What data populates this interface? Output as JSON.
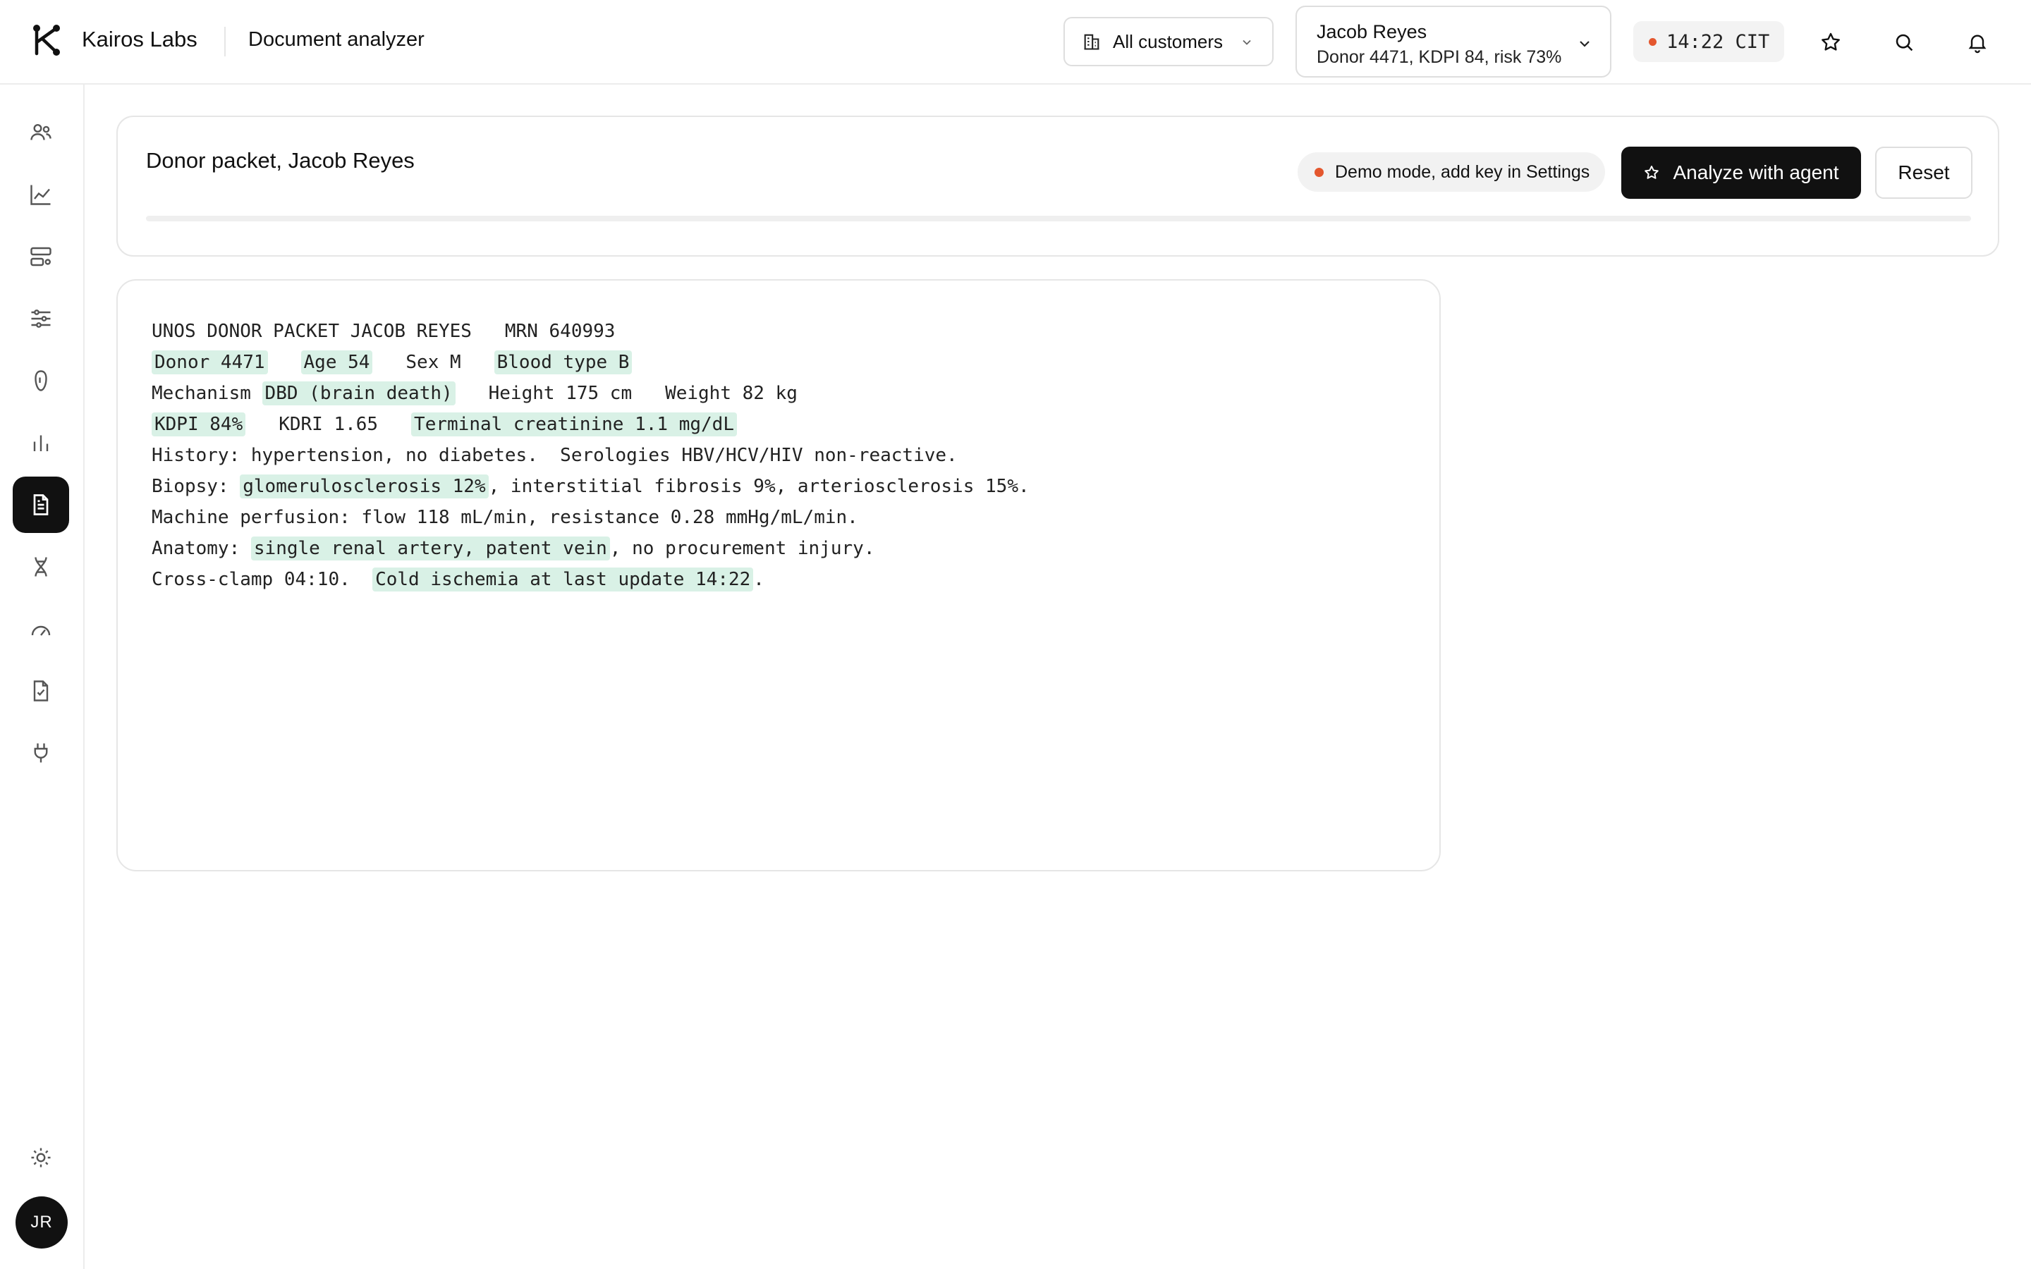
{
  "header": {
    "brand": "Kairos Labs",
    "page_name": "Document analyzer",
    "customer_filter": "All customers",
    "patient": {
      "name": "Jacob Reyes",
      "summary": "Donor 4471, KDPI 84, risk 73%"
    },
    "clock": "14:22 CIT",
    "status_dot_color": "#e4572e"
  },
  "sidebar": {
    "items": [
      {
        "icon": "users-icon",
        "active": false
      },
      {
        "icon": "line-chart-icon",
        "active": false
      },
      {
        "icon": "servers-icon",
        "active": false
      },
      {
        "icon": "sliders-icon",
        "active": false
      },
      {
        "icon": "kidney-icon",
        "active": false
      },
      {
        "icon": "bar-chart-icon",
        "active": false
      },
      {
        "icon": "document-icon",
        "active": true
      },
      {
        "icon": "dna-icon",
        "active": false
      },
      {
        "icon": "gauge-icon",
        "active": false
      },
      {
        "icon": "checklist-icon",
        "active": false
      },
      {
        "icon": "plug-icon",
        "active": false
      }
    ],
    "theme_icon": "sun-icon",
    "avatar_initials": "JR"
  },
  "toolbar": {
    "title": "Donor packet, Jacob Reyes",
    "demo_notice": "Demo mode, add key in Settings",
    "analyze_label": "Analyze with agent",
    "reset_label": "Reset",
    "progress": 0
  },
  "document": {
    "lines": [
      [
        {
          "t": "UNOS DONOR PACKET JACOB REYES   MRN 640993",
          "h": false
        }
      ],
      [
        {
          "t": "Donor 4471",
          "h": true
        },
        {
          "t": "   ",
          "h": false
        },
        {
          "t": "Age 54",
          "h": true
        },
        {
          "t": "   Sex M   ",
          "h": false
        },
        {
          "t": "Blood type B",
          "h": true
        }
      ],
      [
        {
          "t": "Mechanism ",
          "h": false
        },
        {
          "t": "DBD (brain death)",
          "h": true
        },
        {
          "t": "   Height 175 cm   Weight 82 kg",
          "h": false
        }
      ],
      [
        {
          "t": "KDPI 84%",
          "h": true
        },
        {
          "t": "   KDRI 1.65   ",
          "h": false
        },
        {
          "t": "Terminal creatinine 1.1 mg/dL",
          "h": true
        }
      ],
      [
        {
          "t": "History: hypertension, no diabetes.  Serologies HBV/HCV/HIV non-reactive.",
          "h": false
        }
      ],
      [
        {
          "t": "Biopsy: ",
          "h": false
        },
        {
          "t": "glomerulosclerosis 12%",
          "h": true
        },
        {
          "t": ", interstitial fibrosis 9%, arteriosclerosis 15%.",
          "h": false
        }
      ],
      [
        {
          "t": "Machine perfusion: flow 118 mL/min, resistance 0.28 mmHg/mL/min.",
          "h": false
        }
      ],
      [
        {
          "t": "Anatomy: ",
          "h": false
        },
        {
          "t": "single renal artery, patent vein",
          "h": true
        },
        {
          "t": ", no procurement injury.",
          "h": false
        }
      ],
      [
        {
          "t": "Cross-clamp 04:10.  ",
          "h": false
        },
        {
          "t": "Cold ischemia at last update 14:22",
          "h": true
        },
        {
          "t": ".",
          "h": false
        }
      ]
    ],
    "highlight_color": "#d9f1e6"
  }
}
